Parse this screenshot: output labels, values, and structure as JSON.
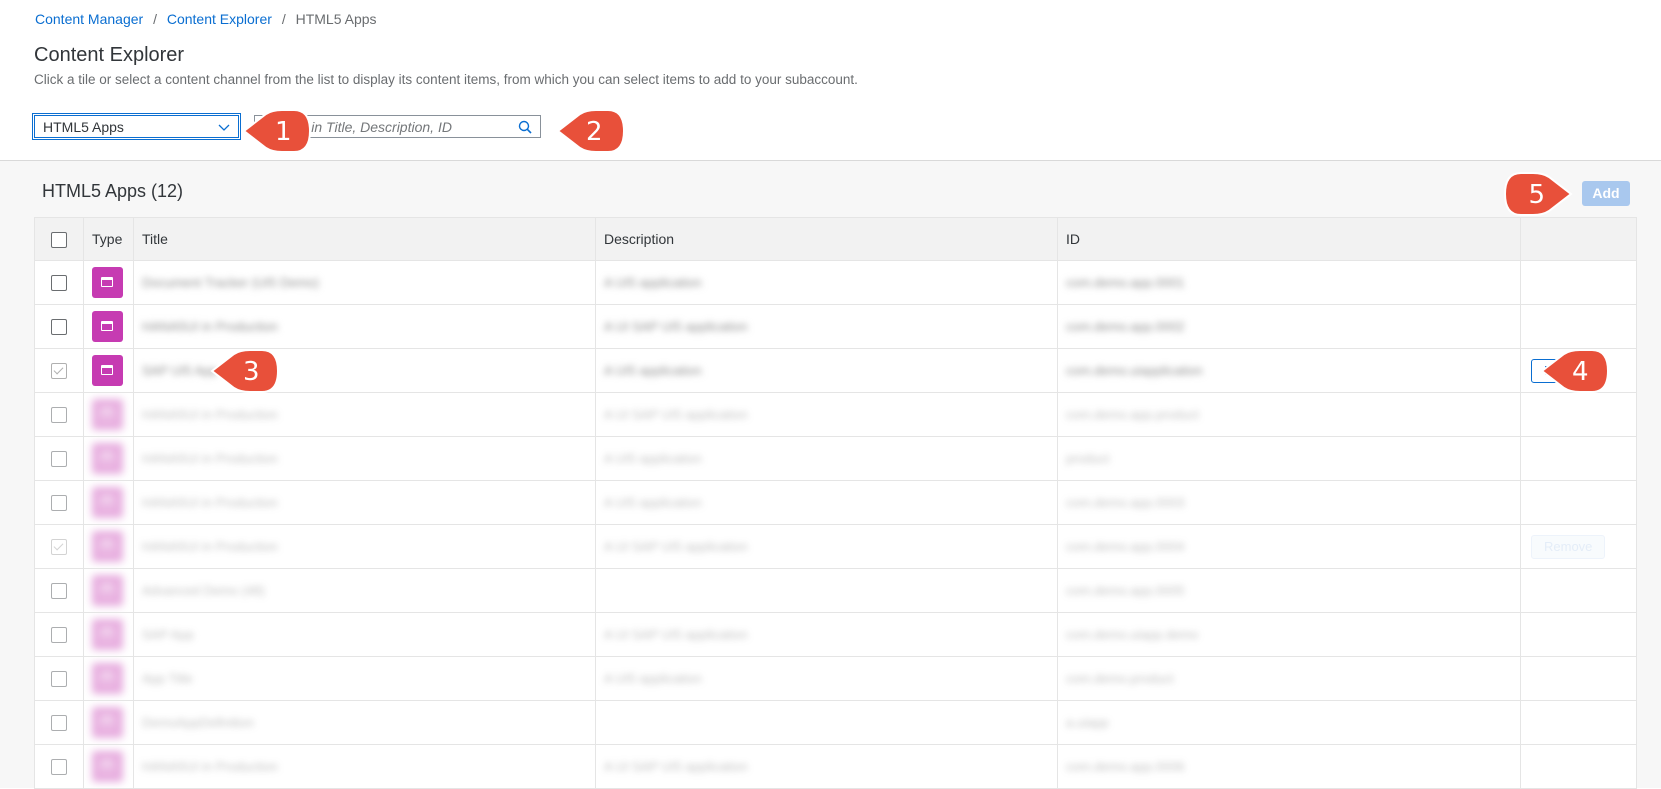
{
  "breadcrumb": {
    "items": [
      "Content Manager",
      "Content Explorer",
      "HTML5 Apps"
    ],
    "separator": "/"
  },
  "page": {
    "title": "Content Explorer",
    "description": "Click a tile or select a content channel from the list to display its content items, from which you can select items to add to your subaccount."
  },
  "channel_select": {
    "value": "HTML5 Apps"
  },
  "search": {
    "placeholder": "Search in Title, Description, ID"
  },
  "table": {
    "title": "HTML5 Apps (12)",
    "add_label": "Add",
    "columns": [
      "Type",
      "Title",
      "Description",
      "ID"
    ],
    "rows": [
      {
        "checked": false,
        "title": "Document Tracker (UI5 Demo)",
        "description": "A UI5 application",
        "id": "com.demo.app.0001",
        "remove": false
      },
      {
        "checked": false,
        "title": "HANA5UI in Production",
        "description": "A UI SAP UI5 application",
        "id": "com.demo.app.0002",
        "remove": false
      },
      {
        "checked": true,
        "title": "SAP UI5 App",
        "description": "A UI5 application",
        "id": "com.demo.uiapplication",
        "remove": true
      },
      {
        "checked": false,
        "title": "HANA5UI in Production",
        "description": "A UI SAP UI5 application",
        "id": "com.demo.app.product",
        "remove": false
      },
      {
        "checked": false,
        "title": "HANA5UI in Production",
        "description": "A UI5 application",
        "id": "product",
        "remove": false
      },
      {
        "checked": false,
        "title": "HANA5UI in Production",
        "description": "A UI5 application",
        "id": "com.demo.app.0003",
        "remove": false
      },
      {
        "checked": true,
        "title": "HANA5UI in Production",
        "description": "A UI SAP UI5 application",
        "id": "com.demo.app.0004",
        "remove": true
      },
      {
        "checked": false,
        "title": "Advanced Demo (48)",
        "description": "",
        "id": "com.demo.app.0005",
        "remove": false
      },
      {
        "checked": false,
        "title": "SAP App",
        "description": "A UI SAP UI5 application",
        "id": "com.demo.uiapp.demo",
        "remove": false
      },
      {
        "checked": false,
        "title": "App Title",
        "description": "A UI5 application",
        "id": "com.demo.product",
        "remove": false
      },
      {
        "checked": false,
        "title": "DemoAppDefinition",
        "description": "",
        "id": "a.uiapp",
        "remove": false
      },
      {
        "checked": false,
        "title": "HANA5UI in Production",
        "description": "A UI SAP UI5 application",
        "id": "com.demo.app.0006",
        "remove": false
      }
    ],
    "remove_label": "Remove"
  },
  "callouts": [
    "1",
    "2",
    "3",
    "4",
    "5"
  ],
  "colors": {
    "accent": "#0a6ed1",
    "type_icon": "#c63bb2",
    "callout": "#e8503a",
    "add_button": "#a9c8ee"
  }
}
